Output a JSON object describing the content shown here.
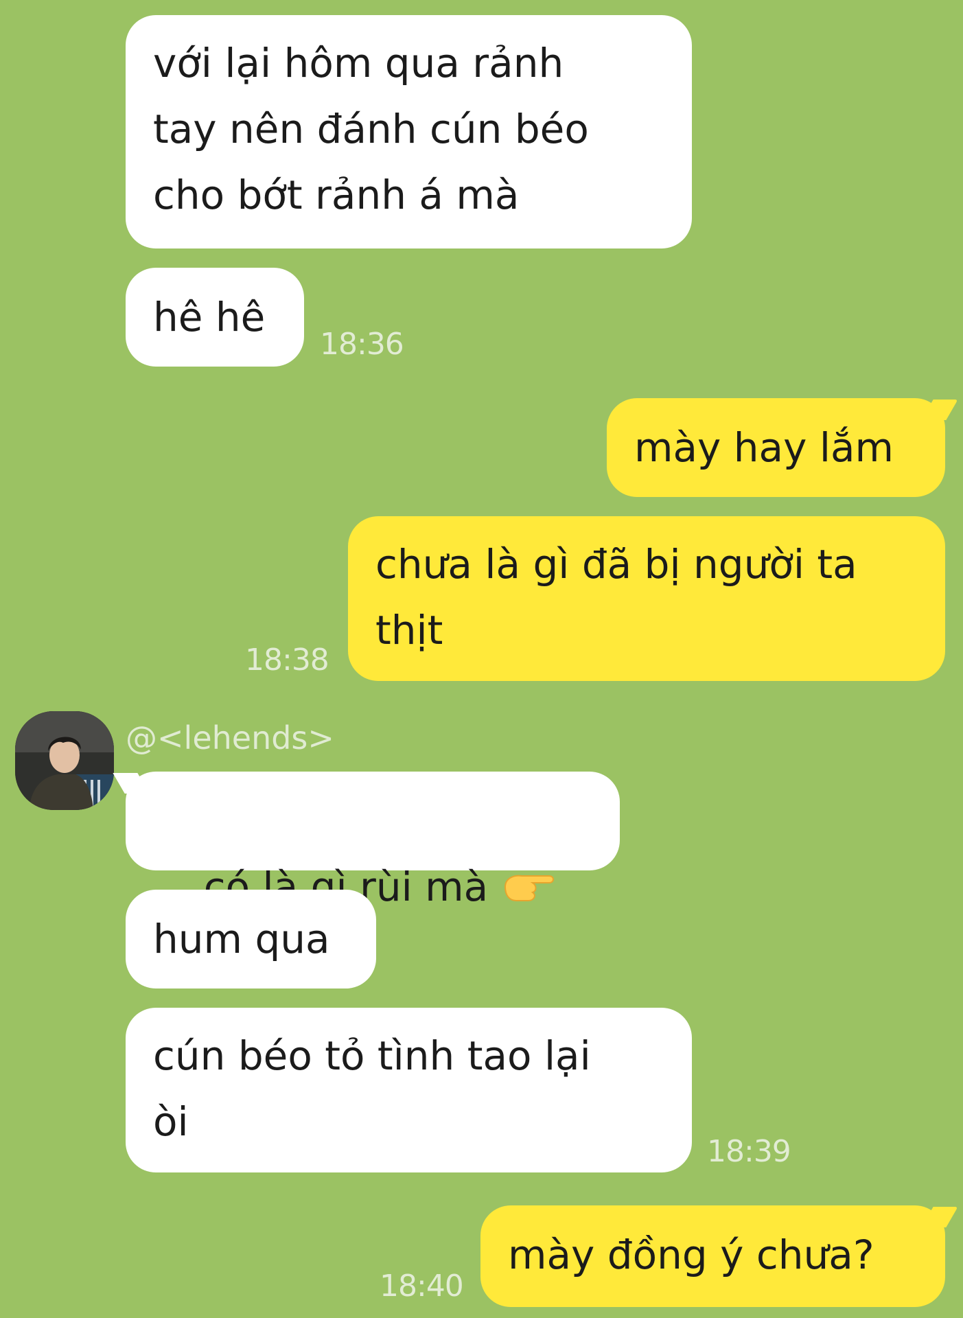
{
  "messages": [
    {
      "id": "m1",
      "direction": "received",
      "text": "với lại hôm qua rảnh\ntay nên đánh cún béo\ncho bớt rảnh á mà"
    },
    {
      "id": "m2",
      "direction": "received",
      "text": "hê hê",
      "time": "18:36"
    },
    {
      "id": "m3",
      "direction": "sent",
      "text": "mày hay lắm"
    },
    {
      "id": "m4",
      "direction": "sent",
      "text": "chưa là gì đã bị người ta\nthịt",
      "time": "18:38"
    },
    {
      "id": "m5",
      "direction": "received",
      "sender": "@<lehends>",
      "text": "có là gì rùi mà ",
      "emoji": "backhand-index-pointing-right-left-icons"
    },
    {
      "id": "m6",
      "direction": "received",
      "text": "hum qua"
    },
    {
      "id": "m7",
      "direction": "received",
      "text": "cún béo tỏ tình tao lại\nòi",
      "time": "18:39"
    },
    {
      "id": "m8",
      "direction": "sent",
      "text": "mày đồng ý chưa?",
      "time": "18:40"
    }
  ],
  "colors": {
    "background": "#9bc263",
    "received_bubble": "#ffffff",
    "sent_bubble": "#ffe93a",
    "timestamp": "#e2ecd4"
  }
}
